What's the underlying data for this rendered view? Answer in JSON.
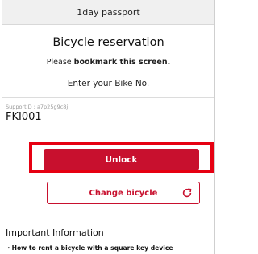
{
  "topbar": {
    "title": "1day passport"
  },
  "main": {
    "title": "Bicycle reservation",
    "bookmark_prefix": "Please ",
    "bookmark_bold": "bookmark this screen.",
    "enter_prompt": "Enter your Bike No."
  },
  "bike": {
    "support_id": "SupportID : a7p25g9c8j",
    "bike_no": "FKI001"
  },
  "actions": {
    "unlock_label": "Unlock",
    "change_label": "Change bicycle"
  },
  "info": {
    "title": "Important Information",
    "items": [
      "・How to rent a bicycle with a square key device"
    ]
  },
  "colors": {
    "accent": "#c8102e",
    "highlight": "#e60012"
  },
  "icons": {
    "change": "refresh-icon"
  }
}
